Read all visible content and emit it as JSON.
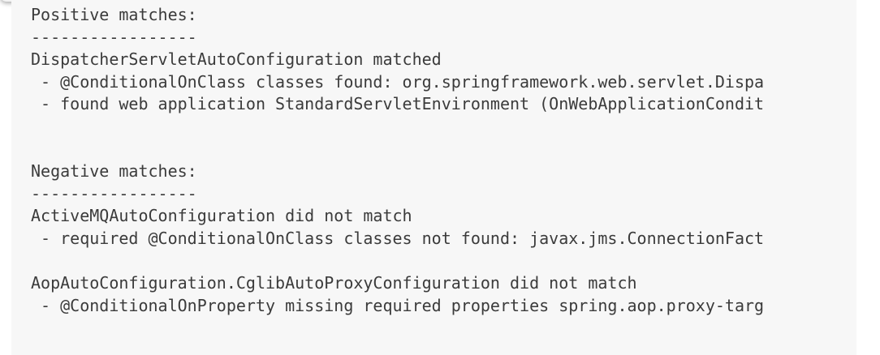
{
  "log": {
    "positive_header": "Positive matches:",
    "positive_divider": "-----------------",
    "positive_item_title": "DispatcherServletAutoConfiguration matched",
    "positive_item_detail_1": " - @ConditionalOnClass classes found: org.springframework.web.servlet.Dispa",
    "positive_item_detail_2": " - found web application StandardServletEnvironment (OnWebApplicationCondit",
    "negative_header": "Negative matches:",
    "negative_divider": "-----------------",
    "negative_item_1_title": "ActiveMQAutoConfiguration did not match",
    "negative_item_1_detail": " - required @ConditionalOnClass classes not found: javax.jms.ConnectionFact",
    "negative_item_2_title": "AopAutoConfiguration.CglibAutoProxyConfiguration did not match",
    "negative_item_2_detail": " - @ConditionalOnProperty missing required properties spring.aop.proxy-targ"
  }
}
